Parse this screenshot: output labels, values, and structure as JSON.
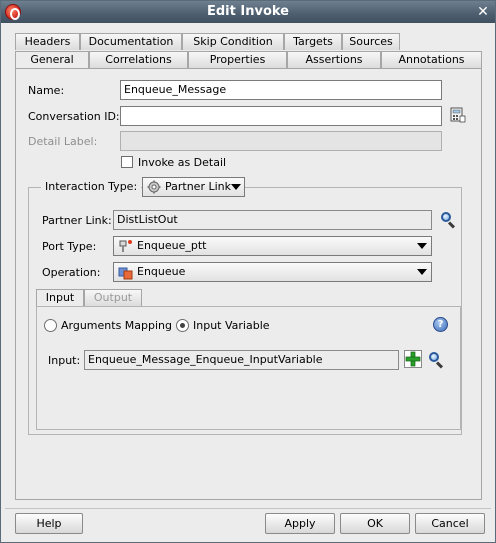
{
  "window": {
    "title": "Edit Invoke"
  },
  "tabs_top": [
    {
      "label": "Headers"
    },
    {
      "label": "Documentation"
    },
    {
      "label": "Skip Condition"
    },
    {
      "label": "Targets"
    },
    {
      "label": "Sources"
    }
  ],
  "tabs_bottom": [
    {
      "label": "General",
      "selected": true
    },
    {
      "label": "Correlations"
    },
    {
      "label": "Properties"
    },
    {
      "label": "Assertions"
    },
    {
      "label": "Annotations"
    }
  ],
  "form": {
    "name_label": "Name:",
    "name_value": "Enqueue_Message",
    "conversation_label": "Conversation ID:",
    "conversation_value": "",
    "detail_label": "Detail Label:",
    "detail_value": "",
    "invoke_as_detail_label": "Invoke as Detail",
    "invoke_as_detail_checked": false
  },
  "interaction": {
    "type_label": "Interaction Type:",
    "type_value": "Partner Link",
    "partner_link_label": "Partner Link:",
    "partner_link_value": "DistListOut",
    "port_type_label": "Port Type:",
    "port_type_value": "Enqueue_ptt",
    "operation_label": "Operation:",
    "operation_value": "Enqueue"
  },
  "io_tabs": [
    {
      "label": "Input",
      "selected": true
    },
    {
      "label": "Output",
      "selected": false
    }
  ],
  "input_panel": {
    "args_mapping_label": "Arguments Mapping",
    "input_variable_label": "Input Variable",
    "selected_mode": "Input Variable",
    "input_label": "Input:",
    "input_value": "Enqueue_Message_Enqueue_InputVariable"
  },
  "buttons": {
    "help": "Help",
    "apply": "Apply",
    "ok": "OK",
    "cancel": "Cancel"
  },
  "icons": {
    "app": "oracle-logo-icon",
    "close": "close-icon",
    "conversation": "calculator-icon",
    "search": "magnifier-icon",
    "add": "add-plus-icon",
    "help": "help-question-icon",
    "partner_link": "gear-icon",
    "port_type": "port-type-icon",
    "operation": "operation-icon"
  }
}
